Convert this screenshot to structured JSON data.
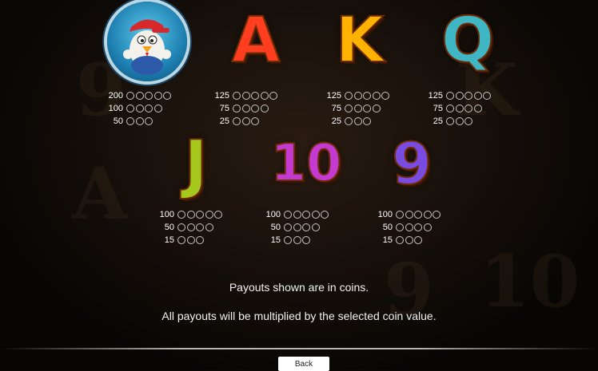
{
  "symbols": [
    {
      "id": "mascot",
      "label": "",
      "payouts": [
        {
          "count": 5,
          "value": "200"
        },
        {
          "count": 4,
          "value": "100"
        },
        {
          "count": 3,
          "value": "50"
        }
      ]
    },
    {
      "id": "A",
      "label": "A",
      "color": "#ff3d1f",
      "payouts": [
        {
          "count": 5,
          "value": "125"
        },
        {
          "count": 4,
          "value": "75"
        },
        {
          "count": 3,
          "value": "25"
        }
      ]
    },
    {
      "id": "K",
      "label": "K",
      "color": "#ffb300",
      "payouts": [
        {
          "count": 5,
          "value": "125"
        },
        {
          "count": 4,
          "value": "75"
        },
        {
          "count": 3,
          "value": "25"
        }
      ]
    },
    {
      "id": "Q",
      "label": "Q",
      "color": "#3fb6c4",
      "payouts": [
        {
          "count": 5,
          "value": "125"
        },
        {
          "count": 4,
          "value": "75"
        },
        {
          "count": 3,
          "value": "25"
        }
      ]
    },
    {
      "id": "J",
      "label": "J",
      "color": "#a6c81c",
      "payouts": [
        {
          "count": 5,
          "value": "100"
        },
        {
          "count": 4,
          "value": "50"
        },
        {
          "count": 3,
          "value": "15"
        }
      ]
    },
    {
      "id": "10",
      "label": "10",
      "color": "#c43ad1",
      "payouts": [
        {
          "count": 5,
          "value": "100"
        },
        {
          "count": 4,
          "value": "50"
        },
        {
          "count": 3,
          "value": "15"
        }
      ]
    },
    {
      "id": "9",
      "label": "9",
      "color": "#7a4be0",
      "payouts": [
        {
          "count": 5,
          "value": "100"
        },
        {
          "count": 4,
          "value": "50"
        },
        {
          "count": 3,
          "value": "15"
        }
      ]
    }
  ],
  "info": {
    "line1": "Payouts shown are in coins.",
    "line2": "All payouts will be multiplied by the selected coin value."
  },
  "footer": {
    "back_label": "Back"
  }
}
